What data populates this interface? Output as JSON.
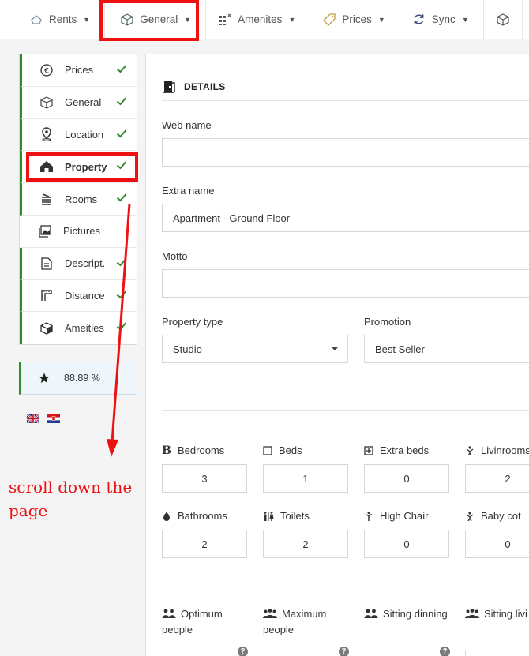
{
  "topnav": {
    "tabs": [
      {
        "label": "Rents",
        "icon": "home-outline-icon"
      },
      {
        "label": "General",
        "icon": "cube-icon"
      },
      {
        "label": "Amenites",
        "icon": "grid-plus-icon"
      },
      {
        "label": "Prices",
        "icon": "tag-icon"
      },
      {
        "label": "Sync",
        "icon": "sync-icon"
      }
    ]
  },
  "sidebar": {
    "items": [
      {
        "label": "Prices",
        "icon": "euro-icon",
        "done": true
      },
      {
        "label": "General",
        "icon": "cube-icon",
        "done": true
      },
      {
        "label": "Location",
        "icon": "map-pin-icon",
        "done": true
      },
      {
        "label": "Property",
        "icon": "house-icon",
        "done": true
      },
      {
        "label": "Rooms",
        "icon": "stack-icon",
        "done": true
      },
      {
        "label": "Pictures",
        "icon": "images-icon",
        "done": false
      },
      {
        "label": "Descript.",
        "icon": "document-icon",
        "done": true
      },
      {
        "label": "Distance",
        "icon": "ruler-icon",
        "done": true
      },
      {
        "label": "Ameities",
        "icon": "box-icon",
        "done": true
      }
    ],
    "score": "88.89 %",
    "languages": [
      "en",
      "hr"
    ]
  },
  "details": {
    "title": "DETAILS",
    "web_name_label": "Web name",
    "web_name_value": "",
    "extra_name_label": "Extra name",
    "extra_name_value": "Apartment - Ground Floor",
    "motto_label": "Motto",
    "motto_value": "",
    "property_type_label": "Property type",
    "property_type_value": "Studio",
    "promotion_label": "Promotion",
    "promotion_value": "Best Seller"
  },
  "counts": {
    "bedrooms": {
      "label": "Bedrooms",
      "value": "3"
    },
    "beds": {
      "label": "Beds",
      "value": "1"
    },
    "extra_beds": {
      "label": "Extra beds",
      "value": "0"
    },
    "livinrooms": {
      "label": "Livinrooms",
      "value": "2"
    },
    "bathrooms": {
      "label": "Bathrooms",
      "value": "2"
    },
    "toilets": {
      "label": "Toilets",
      "value": "2"
    },
    "high_chair": {
      "label": "High Chair",
      "value": "0"
    },
    "baby_cot": {
      "label": "Baby cot",
      "value": "0"
    }
  },
  "people": {
    "optimum": "Optimum people",
    "maximum": "Maximum people",
    "sitting_dinning": "Sitting dinning",
    "sitting_living": "Sitting livi"
  },
  "annotation": {
    "text_line1": "scroll down the",
    "text_line2": "page"
  },
  "colors": {
    "check": "#2e8b2e",
    "annotation": "#ee1111"
  }
}
